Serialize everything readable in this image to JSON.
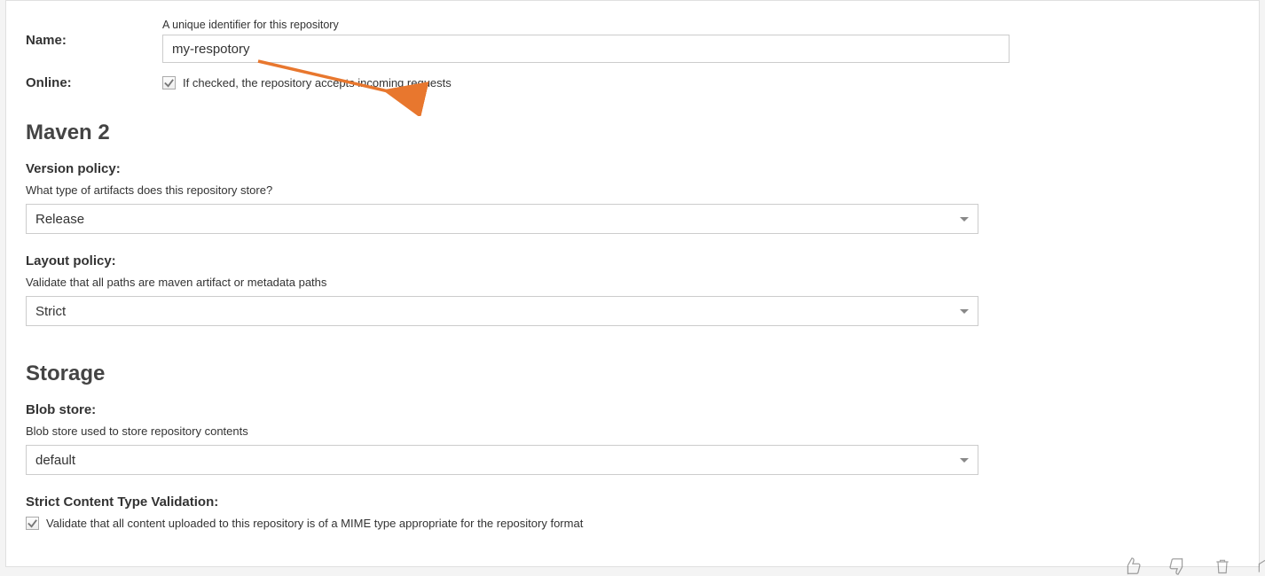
{
  "fields": {
    "name": {
      "label": "Name:",
      "hint": "A unique identifier for this repository",
      "value": "my-respotory"
    },
    "online": {
      "label": "Online:",
      "checkbox_label": "If checked, the repository accepts incoming requests"
    }
  },
  "sections": {
    "maven": {
      "title": "Maven 2",
      "version_policy": {
        "label": "Version policy:",
        "hint": "What type of artifacts does this repository store?",
        "value": "Release"
      },
      "layout_policy": {
        "label": "Layout policy:",
        "hint": "Validate that all paths are maven artifact or metadata paths",
        "value": "Strict"
      }
    },
    "storage": {
      "title": "Storage",
      "blob_store": {
        "label": "Blob store:",
        "hint": "Blob store used to store repository contents",
        "value": "default"
      },
      "strict_content": {
        "label": "Strict Content Type Validation:",
        "checkbox_label": "Validate that all content uploaded to this repository is of a MIME type appropriate for the repository format"
      }
    }
  }
}
